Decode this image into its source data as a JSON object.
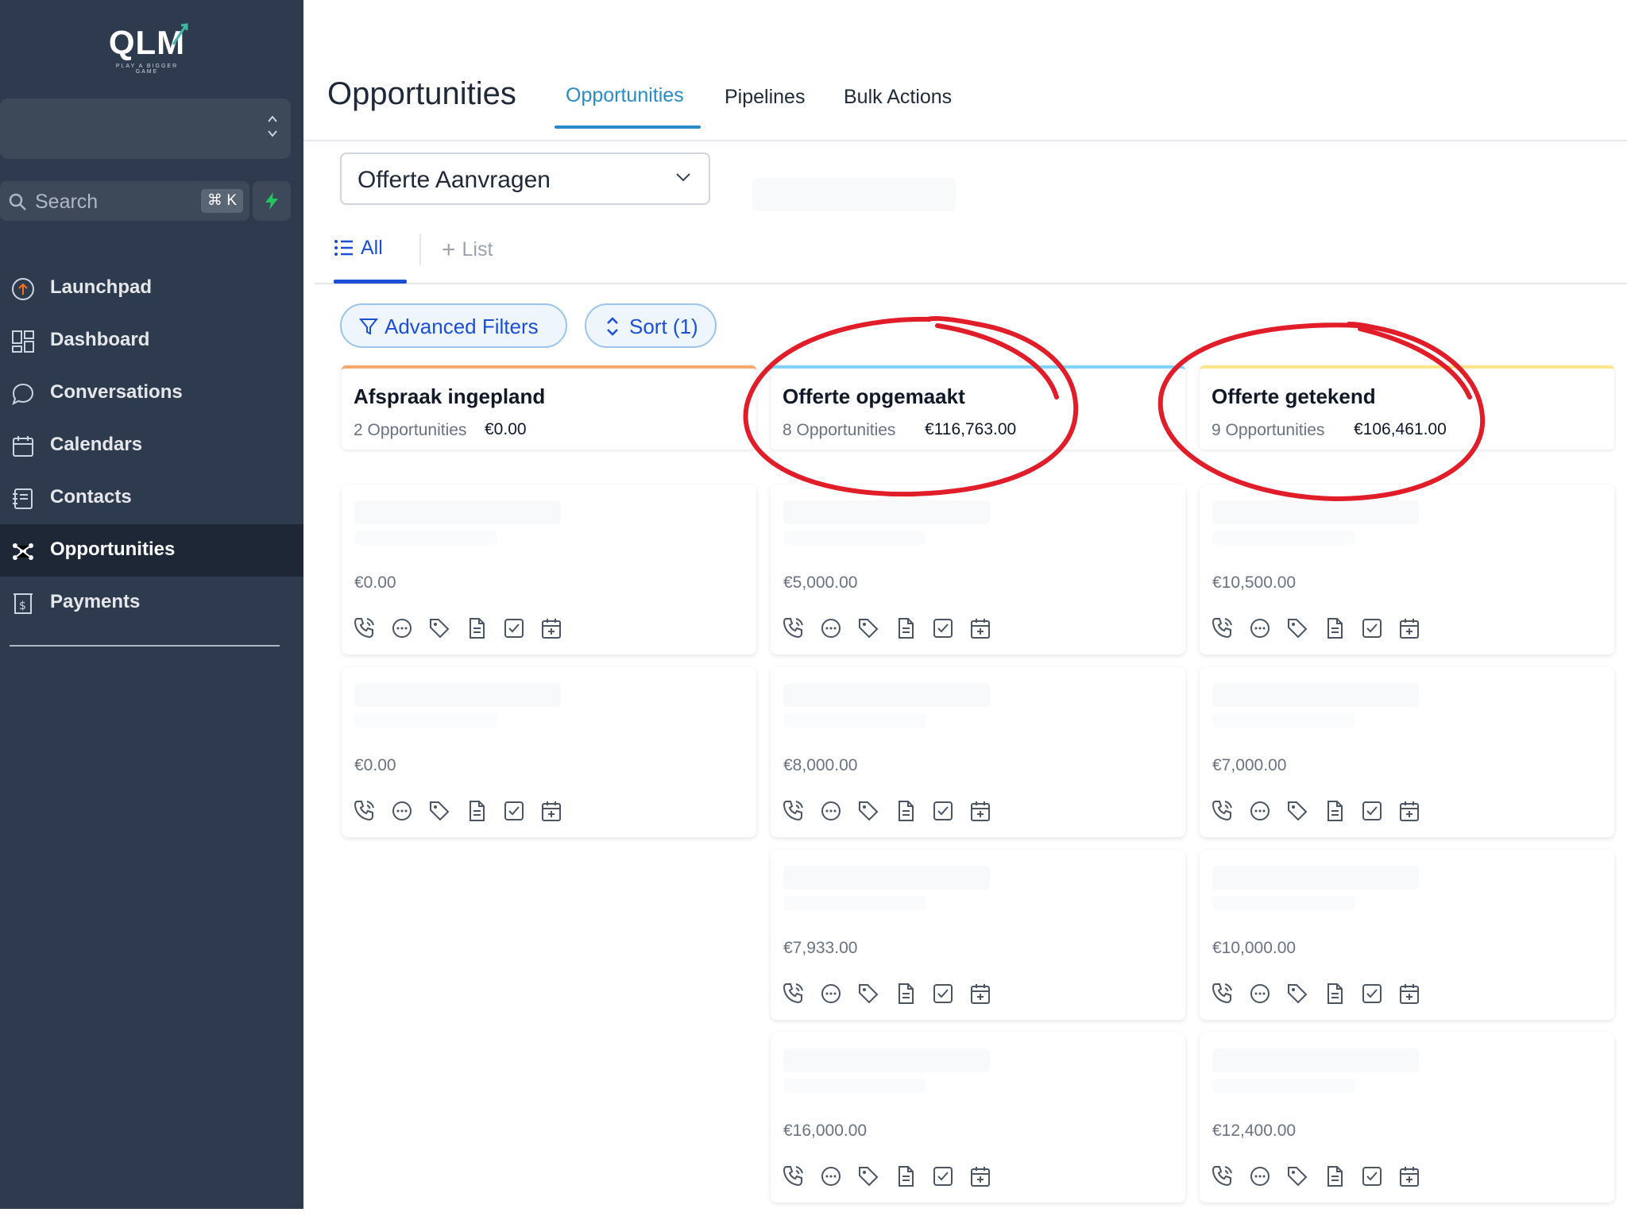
{
  "brand": {
    "logo_text": "QLM",
    "tagline": "PLAY A BIGGER GAME"
  },
  "search": {
    "placeholder": "Search",
    "shortcut": "⌘ K"
  },
  "sidebar": {
    "items": [
      {
        "label": "Launchpad",
        "icon": "launchpad-icon"
      },
      {
        "label": "Dashboard",
        "icon": "dashboard-grid-icon"
      },
      {
        "label": "Conversations",
        "icon": "chat-bubble-icon"
      },
      {
        "label": "Calendars",
        "icon": "calendar-icon"
      },
      {
        "label": "Contacts",
        "icon": "contacts-book-icon"
      },
      {
        "label": "Opportunities",
        "icon": "network-icon",
        "active": true
      },
      {
        "label": "Payments",
        "icon": "dollar-doc-icon"
      }
    ]
  },
  "header": {
    "title": "Opportunities",
    "tabs": [
      {
        "label": "Opportunities",
        "active": true
      },
      {
        "label": "Pipelines"
      },
      {
        "label": "Bulk Actions"
      }
    ]
  },
  "pipeline": {
    "selected": "Offerte Aanvragen"
  },
  "views": {
    "all_label": "All",
    "add_label": "List"
  },
  "filters": {
    "advanced_label": "Advanced Filters",
    "sort_label": "Sort (1)"
  },
  "stages": [
    {
      "name": "Afspraak ingepland",
      "count": "2 Opportunities",
      "value": "€0.00",
      "color": "#f6a96b",
      "cards": [
        "€0.00",
        "€0.00"
      ]
    },
    {
      "name": "Offerte opgemaakt",
      "count": "8 Opportunities",
      "value": "€116,763.00",
      "color": "#7dd3fc",
      "cards": [
        "€5,000.00",
        "€8,000.00",
        "€7,933.00",
        "€16,000.00"
      ]
    },
    {
      "name": "Offerte getekend",
      "count": "9 Opportunities",
      "value": "€106,461.00",
      "color": "#fde68a",
      "cards": [
        "€10,500.00",
        "€7,000.00",
        "€10,000.00",
        "€12,400.00"
      ]
    }
  ],
  "card_actions": [
    "phone-icon",
    "message-icon",
    "tag-icon",
    "document-icon",
    "task-check-icon",
    "calendar-add-icon"
  ],
  "colors": {
    "sidebar_bg": "#2e3a4d",
    "accent": "#2a8bc9",
    "link_blue": "#1d4ed8",
    "annotation_red": "#e11d2a"
  }
}
